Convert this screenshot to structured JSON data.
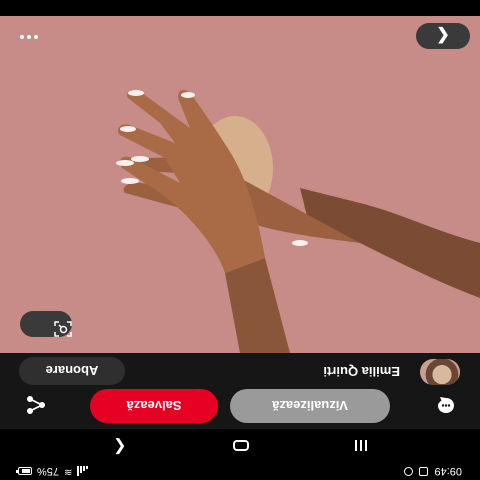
{
  "status_bar": {
    "time": "09:49",
    "battery": "75%",
    "battery_level": 0.75
  },
  "toolbar": {
    "visualize_label": "Vizualizează",
    "save_label": "Salvează"
  },
  "profile": {
    "author": "Emilia Quirti",
    "follow_label": "Abonare"
  },
  "image": {
    "description_icons": [
      "visual-search-icon",
      "back-icon",
      "more-icon"
    ]
  },
  "colors": {
    "save": "#e60023",
    "visualize": "#9a9a9a",
    "background_photo": "#c58a86",
    "toolbar": "#161616"
  }
}
